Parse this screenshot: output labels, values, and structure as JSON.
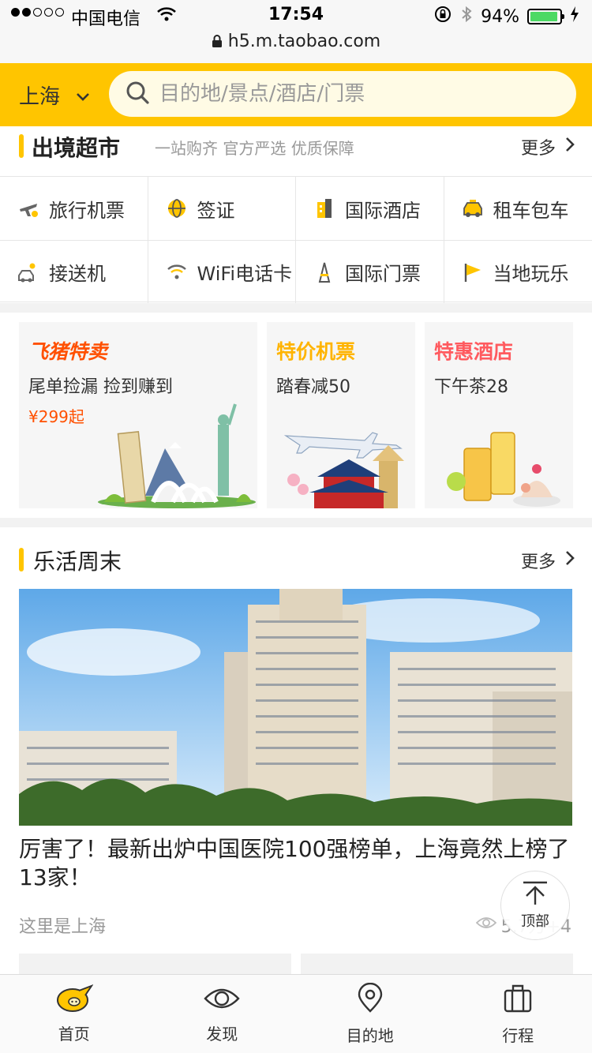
{
  "status_bar": {
    "carrier": "中国电信",
    "time": "17:54",
    "battery": "94%",
    "battery_level": 0.94,
    "url": "h5.m.taobao.com"
  },
  "header": {
    "city": "上海",
    "search_placeholder": "目的地/景点/酒店/门票"
  },
  "overseas": {
    "brand": "出境超市",
    "slogan": "一站购齐 官方严选 优质保障",
    "more": "更多"
  },
  "services": [
    {
      "label": "旅行机票",
      "icon": "plane-icon"
    },
    {
      "label": "签证",
      "icon": "globe-icon"
    },
    {
      "label": "国际酒店",
      "icon": "hotel-icon"
    },
    {
      "label": "租车包车",
      "icon": "taxi-icon"
    },
    {
      "label": "接送机",
      "icon": "car-icon"
    },
    {
      "label": "WiFi电话卡",
      "icon": "wifi-icon"
    },
    {
      "label": "国际门票",
      "icon": "tower-icon"
    },
    {
      "label": "当地玩乐",
      "icon": "flag-icon"
    }
  ],
  "promos": [
    {
      "title": "飞猪特卖",
      "subtitle": "尾单捡漏 捡到赚到",
      "price": "¥299起",
      "title_color": "#ff5000"
    },
    {
      "title": "特价机票",
      "subtitle": "踏春减50",
      "title_color": "#ffb400"
    },
    {
      "title": "特惠酒店",
      "subtitle": "下午茶28",
      "title_color": "#ff5a5f"
    }
  ],
  "weekend": {
    "title": "乐活周末",
    "more": "更多",
    "article": {
      "title": "厉害了！最新出炉中国医院100强榜单，上海竟然上榜了13家！",
      "source": "这里是上海",
      "views": "5.7万+4"
    }
  },
  "to_top": "顶部",
  "tabs": [
    {
      "label": "首页",
      "icon": "home-pig-icon"
    },
    {
      "label": "发现",
      "icon": "discover-eye-icon"
    },
    {
      "label": "目的地",
      "icon": "destination-pin-icon"
    },
    {
      "label": "行程",
      "icon": "luggage-icon"
    }
  ],
  "colors": {
    "accent": "#ffc500",
    "price": "#ff5000"
  }
}
